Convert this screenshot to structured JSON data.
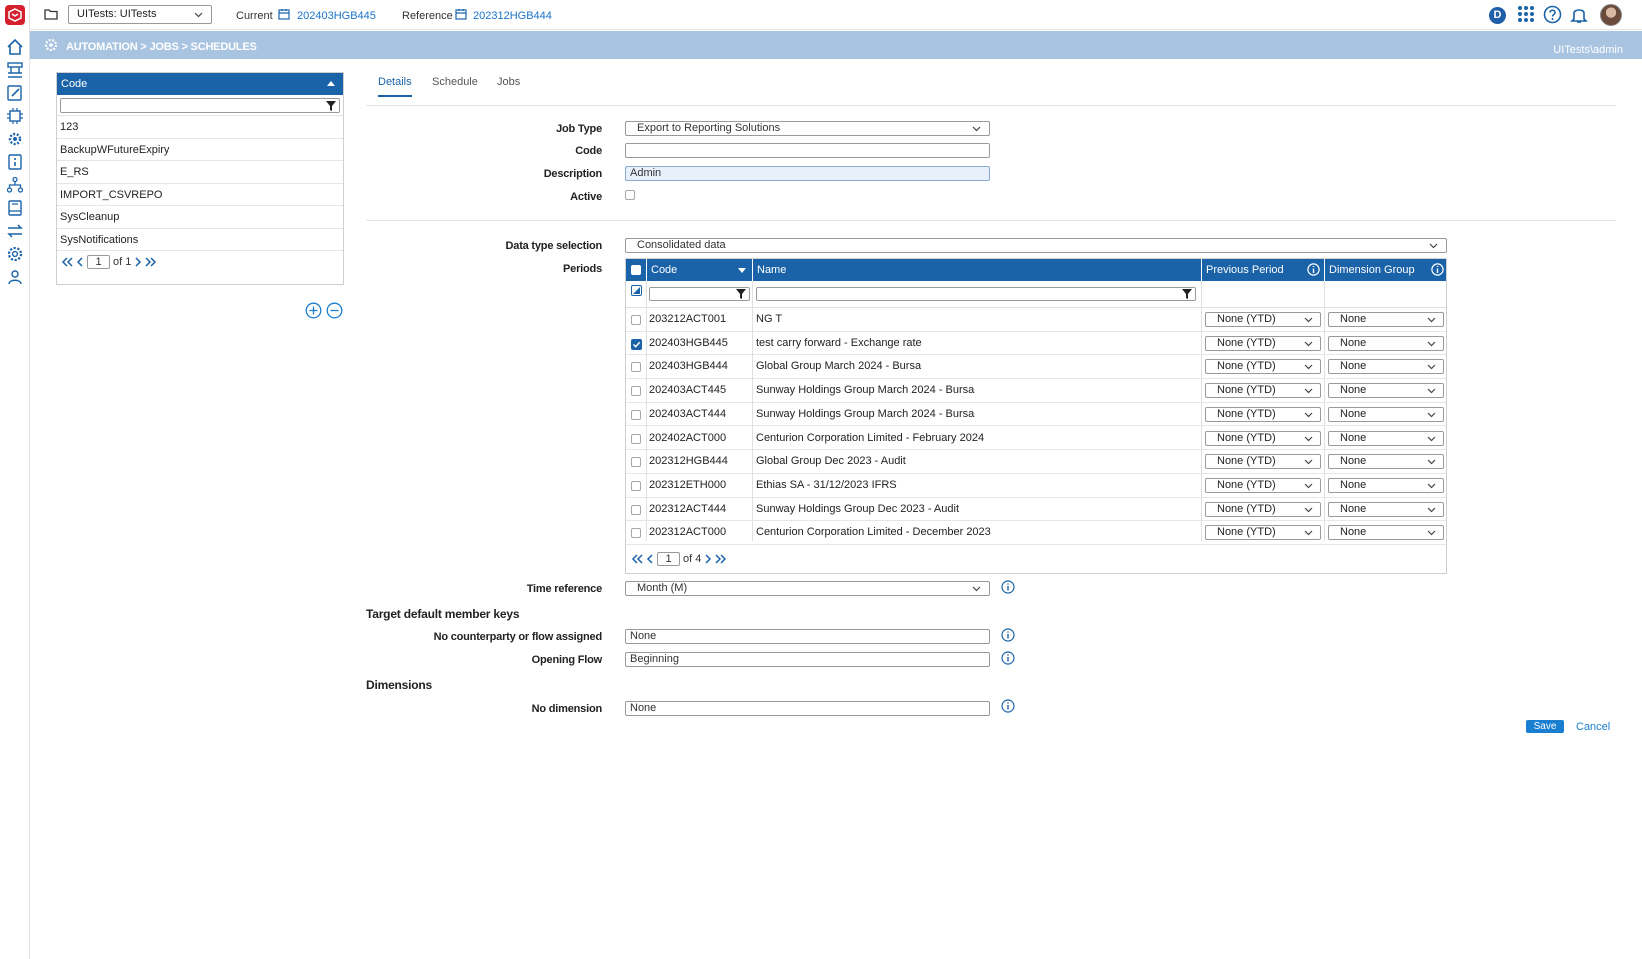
{
  "topbar": {
    "workspace": "UITests: UITests",
    "current_label": "Current",
    "current_value": "202403HGB445",
    "reference_label": "Reference",
    "reference_value": "202312HGB444",
    "badge_letter": "D"
  },
  "breadcrumb": {
    "path": "AUTOMATION > JOBS > SCHEDULES",
    "user": "UITests\\admin"
  },
  "code_list": {
    "header": "Code",
    "items": [
      "123",
      "BackupWFutureExpiry",
      "E_RS",
      "IMPORT_CSVREPO",
      "SysCleanup",
      "SysNotifications"
    ],
    "page": "1",
    "of_label": "of",
    "total_pages": "1"
  },
  "tabs": [
    "Details",
    "Schedule",
    "Jobs"
  ],
  "form": {
    "job_type_label": "Job Type",
    "job_type_value": "Export to Reporting Solutions",
    "code_label": "Code",
    "code_value": "",
    "description_label": "Description",
    "description_value": "Admin",
    "active_label": "Active",
    "data_type_label": "Data type selection",
    "data_type_value": "Consolidated data",
    "periods_label": "Periods",
    "time_reference_label": "Time reference",
    "time_reference_value": "Month (M)",
    "target_section": "Target default member keys",
    "no_counterparty_label": "No counterparty or flow assigned",
    "no_counterparty_value": "None",
    "opening_flow_label": "Opening Flow",
    "opening_flow_value": "Beginning",
    "dimensions_section": "Dimensions",
    "no_dimension_label": "No dimension",
    "no_dimension_value": "None"
  },
  "periods_grid": {
    "columns": [
      "Code",
      "Name",
      "Previous Period",
      "Dimension Group"
    ],
    "rows": [
      {
        "code": "203212ACT001",
        "name": "NG T",
        "prev": "None (YTD)",
        "dim": "None",
        "checked": false
      },
      {
        "code": "202403HGB445",
        "name": "test carry forward - Exchange rate",
        "prev": "None (YTD)",
        "dim": "None",
        "checked": true
      },
      {
        "code": "202403HGB444",
        "name": "Global Group March 2024 - Bursa",
        "prev": "None (YTD)",
        "dim": "None",
        "checked": false
      },
      {
        "code": "202403ACT445",
        "name": "Sunway Holdings Group March 2024 - Bursa",
        "prev": "None (YTD)",
        "dim": "None",
        "checked": false
      },
      {
        "code": "202403ACT444",
        "name": "Sunway Holdings Group March 2024 - Bursa",
        "prev": "None (YTD)",
        "dim": "None",
        "checked": false
      },
      {
        "code": "202402ACT000",
        "name": "Centurion Corporation Limited - February 2024",
        "prev": "None (YTD)",
        "dim": "None",
        "checked": false
      },
      {
        "code": "202312HGB444",
        "name": "Global Group Dec 2023 - Audit",
        "prev": "None (YTD)",
        "dim": "None",
        "checked": false
      },
      {
        "code": "202312ETH000",
        "name": "Ethias SA - 31/12/2023 IFRS",
        "prev": "None (YTD)",
        "dim": "None",
        "checked": false
      },
      {
        "code": "202312ACT444",
        "name": "Sunway Holdings Group Dec 2023 - Audit",
        "prev": "None (YTD)",
        "dim": "None",
        "checked": false
      },
      {
        "code": "202312ACT000",
        "name": "Centurion Corporation Limited - December 2023",
        "prev": "None (YTD)",
        "dim": "None",
        "checked": false
      }
    ],
    "page": "1",
    "of_label": "of",
    "total_pages": "4"
  },
  "actions": {
    "save": "Save",
    "cancel": "Cancel"
  },
  "colors": {
    "accent": "#1b63a8",
    "breadcrumb_bar": "#a9c4e1",
    "brand_red": "#d5212e"
  }
}
